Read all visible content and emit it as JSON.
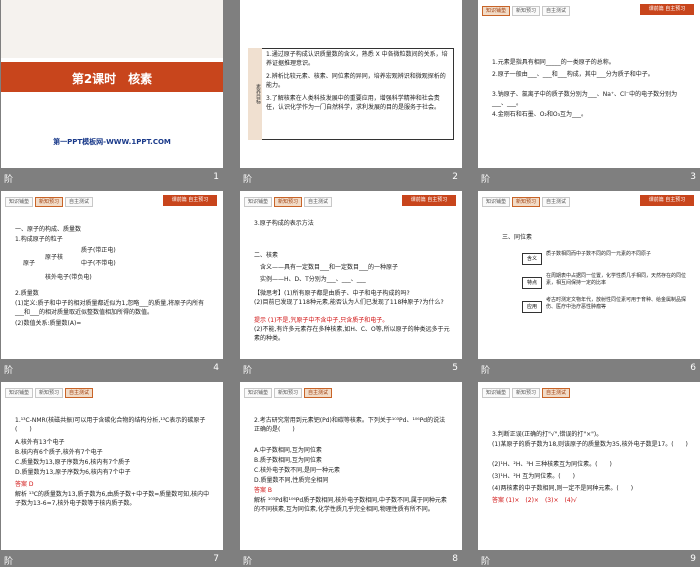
{
  "slides": [
    {
      "num": "1",
      "label": "阶",
      "title": "第2课时　核素",
      "site": "第一PPT模板网-WWW.1PPT.COM"
    },
    {
      "num": "2",
      "label": "阶",
      "side": "素养目标",
      "lines": [
        "1.通过原子构成认识质量数的含义，熟悉 X 中各微粒数间的关系，培养证据推理意识。",
        "2.辨析比较元素、核素、同位素的异同，培养宏观辨识和微观探析的能力。",
        "3.了解核素在人类科技发展中的重要应用，增强科学精神和社会责任，认识化学作为一门自然科学，求利发展的目的是服务于社会。"
      ]
    },
    {
      "num": "3",
      "label": "阶",
      "nav": [
        "知识铺垫",
        "新知预习",
        "自主测试"
      ],
      "hdr": "课前篇 自主预习",
      "lines": [
        "1.元素是指具有相同_____的一类原子的总称。",
        "2.原子一般由___、___和___构成，其中___分为质子和中子。",
        "3.钠原子、氯离子中的质子数分别为___、Na⁺、Cl⁻中的电子数分别为___、___。",
        "4.金刚石和石墨、O₂和O₃互为___。"
      ]
    },
    {
      "num": "4",
      "label": "阶",
      "nav": [
        "知识铺垫",
        "新知预习",
        "自主测试"
      ],
      "hdr": "课前篇 自主预习",
      "lines": [
        "一、原子的构成、质量数",
        "1.构成原子的粒子",
        "2.质量数",
        "(1)定义:质子和中子的相对质量都近似为1,忽略___的质量,将原子内所有___和___的相对质量取近似整数值相加所得的数值。",
        "(2)数值关系:质量数(A)="
      ],
      "tree": {
        "root": "原子",
        "nucleus": "原子核",
        "p": "质子(带正电)",
        "n": "中子(不带电)",
        "e": "核外电子(带负电)"
      }
    },
    {
      "num": "5",
      "label": "阶",
      "nav": [
        "知识铺垫",
        "新知预习",
        "自主测试"
      ],
      "hdr": "课前篇 自主预习",
      "lines": [
        "3.原子构成的表示方法",
        "二、核素",
        "【微思考】(1)所有原子都是由质子、中子和电子构成的吗?",
        "(2)目前已发现了118种元素,能否认为人们已发现了118种原子?为什么?",
        "提示 (1)不是,氕原子中不含中子,只含质子和电子。",
        "(2)不能,有许多元素存在多种核素,如H、C、O等,所以原子的种类远多于元素的种类。"
      ],
      "def": "含义——具有一定数目___和一定数目___的一种原子",
      "ex": "实例——H、D、T分别为___、___、___"
    },
    {
      "num": "6",
      "label": "阶",
      "nav": [
        "知识铺垫",
        "新知预习",
        "自主测试"
      ],
      "hdr": "课前篇 自主预习",
      "lines": [
        "三、同位素"
      ],
      "items": [
        "含义",
        "特点",
        "应用"
      ],
      "descs": [
        "质子数相同而中子数不同的同一元素的不同原子",
        "在周期表中占据同一位置，化学性质几乎相同，天然存在的同位素，相互间保持一定的比率",
        "考古时测定文物年代，放射性同位素可用于育种、给金属制品探伤、医疗中治疗恶性肿瘤等"
      ]
    },
    {
      "num": "7",
      "label": "阶",
      "nav": [
        "知识铺垫",
        "新知预习",
        "自主测试"
      ],
      "lines": [
        "1.¹³C-NMR(核磁共振)可以用于含碳化合物的结构分析,¹³C表示的碳原子(　　)",
        "A.核外有13个电子",
        "B.核内有6个质子,核外有7个电子",
        "C.质量数为13,原子序数为6,核内有7个质子",
        "D.质量数为13,原子序数为6,核内有7个中子",
        "答案 D",
        "解析 ¹³C的质量数为13,质子数为6,由质子数+中子数=质量数可知,核内中子数为13-6=7,核外电子数等于核内质子数。"
      ]
    },
    {
      "num": "8",
      "label": "阶",
      "nav": [
        "知识铺垫",
        "新知预习",
        "自主测试"
      ],
      "lines": [
        "2.考古研究常用到元素钯(Pd)和碳等核素。下列关于¹⁰³Pd、¹⁰⁶Pd的说法正确的是(　　)",
        "A.中子数相同,互为同位素",
        "B.质子数相同,互为同位素",
        "C.核外电子数不同,是同一种元素",
        "D.质量数不同,性质完全相同",
        "答案 B",
        "解析 ¹⁰³Pd和¹⁰⁶Pd质子数相同,核外电子数相同,中子数不同,属于同种元素的不同核素,互为同位素,化学性质几乎完全相同,物理性质有所不同。"
      ]
    },
    {
      "num": "9",
      "label": "阶",
      "nav": [
        "知识铺垫",
        "新知预习",
        "自主测试"
      ],
      "lines": [
        "3.判断正误(正确的打\"√\",错误的打\"×\")。",
        "(1)某原子的质子数为18,则该原子的质量数为35,核外电子数是17。(　　)",
        "(2)¹H、²H、³H 三种核素互为同位素。(　　)",
        "(3)¹H、²H 互为同位素。(　　)",
        "(4)两核素的中子数相同,则一定不是同种元素。(　　)",
        "答案 (1)×　(2)×　(3)×　(4)√"
      ]
    }
  ]
}
